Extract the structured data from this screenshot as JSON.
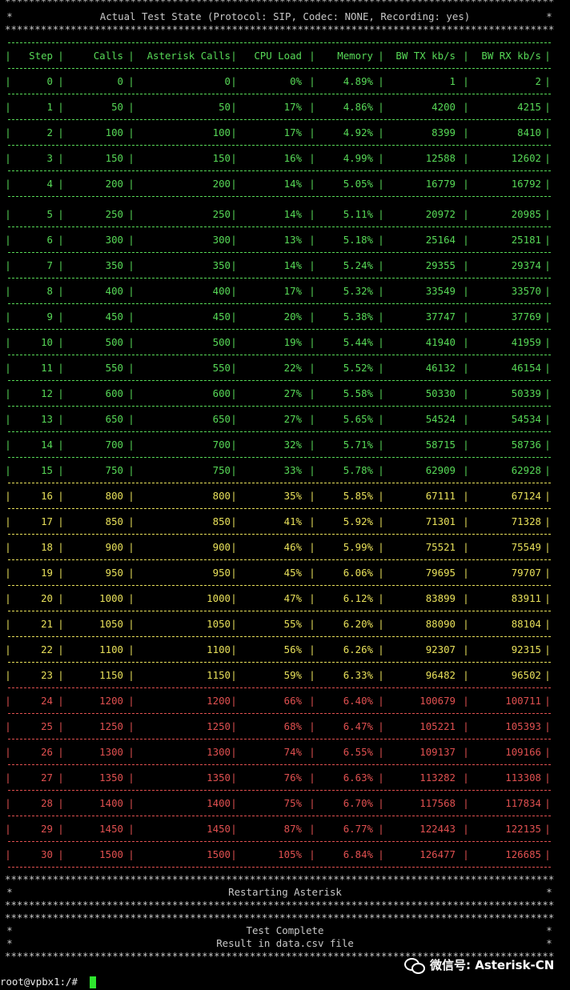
{
  "terminal": {
    "title_line": "Actual Test State (Protocol: SIP, Codec: NONE, Recording: yes)",
    "star_line": "********************************************************************************************",
    "star_char": "*",
    "restart_text": "Restarting Asterisk",
    "complete_text": "Test Complete",
    "result_text": "Result in data.csv file",
    "prompt": "root@vpbx1:/# ",
    "colors": {
      "green": "#57d957",
      "yellow": "#e8e05a",
      "red": "#e05050",
      "border": "#c8c8c8",
      "cursor": "#2ee62e"
    }
  },
  "table": {
    "headers": [
      "Step",
      "Calls",
      "Asterisk Calls",
      "CPU Load",
      "Memory",
      "BW TX kb/s",
      "BW RX kb/s"
    ],
    "rows": [
      {
        "step": "0",
        "calls": "0",
        "ast": "0",
        "cpu": "0%",
        "mem": "4.89%",
        "tx": "1",
        "rx": "2",
        "level": "green"
      },
      {
        "step": "1",
        "calls": "50",
        "ast": "50",
        "cpu": "17%",
        "mem": "4.86%",
        "tx": "4200",
        "rx": "4215",
        "level": "green"
      },
      {
        "step": "2",
        "calls": "100",
        "ast": "100",
        "cpu": "17%",
        "mem": "4.92%",
        "tx": "8399",
        "rx": "8410",
        "level": "green"
      },
      {
        "step": "3",
        "calls": "150",
        "ast": "150",
        "cpu": "16%",
        "mem": "4.99%",
        "tx": "12588",
        "rx": "12602",
        "level": "green"
      },
      {
        "step": "4",
        "calls": "200",
        "ast": "200",
        "cpu": "14%",
        "mem": "5.05%",
        "tx": "16779",
        "rx": "16792",
        "level": "green"
      },
      {
        "step": "5",
        "calls": "250",
        "ast": "250",
        "cpu": "14%",
        "mem": "5.11%",
        "tx": "20972",
        "rx": "20985",
        "level": "green"
      },
      {
        "step": "6",
        "calls": "300",
        "ast": "300",
        "cpu": "13%",
        "mem": "5.18%",
        "tx": "25164",
        "rx": "25181",
        "level": "green"
      },
      {
        "step": "7",
        "calls": "350",
        "ast": "350",
        "cpu": "14%",
        "mem": "5.24%",
        "tx": "29355",
        "rx": "29374",
        "level": "green"
      },
      {
        "step": "8",
        "calls": "400",
        "ast": "400",
        "cpu": "17%",
        "mem": "5.32%",
        "tx": "33549",
        "rx": "33570",
        "level": "green"
      },
      {
        "step": "9",
        "calls": "450",
        "ast": "450",
        "cpu": "20%",
        "mem": "5.38%",
        "tx": "37747",
        "rx": "37769",
        "level": "green"
      },
      {
        "step": "10",
        "calls": "500",
        "ast": "500",
        "cpu": "19%",
        "mem": "5.44%",
        "tx": "41940",
        "rx": "41959",
        "level": "green"
      },
      {
        "step": "11",
        "calls": "550",
        "ast": "550",
        "cpu": "22%",
        "mem": "5.52%",
        "tx": "46132",
        "rx": "46154",
        "level": "green"
      },
      {
        "step": "12",
        "calls": "600",
        "ast": "600",
        "cpu": "27%",
        "mem": "5.58%",
        "tx": "50330",
        "rx": "50339",
        "level": "green"
      },
      {
        "step": "13",
        "calls": "650",
        "ast": "650",
        "cpu": "27%",
        "mem": "5.65%",
        "tx": "54524",
        "rx": "54534",
        "level": "green"
      },
      {
        "step": "14",
        "calls": "700",
        "ast": "700",
        "cpu": "32%",
        "mem": "5.71%",
        "tx": "58715",
        "rx": "58736",
        "level": "green"
      },
      {
        "step": "15",
        "calls": "750",
        "ast": "750",
        "cpu": "33%",
        "mem": "5.78%",
        "tx": "62909",
        "rx": "62928",
        "level": "green"
      },
      {
        "step": "16",
        "calls": "800",
        "ast": "800",
        "cpu": "35%",
        "mem": "5.85%",
        "tx": "67111",
        "rx": "67124",
        "level": "yellow"
      },
      {
        "step": "17",
        "calls": "850",
        "ast": "850",
        "cpu": "41%",
        "mem": "5.92%",
        "tx": "71301",
        "rx": "71328",
        "level": "yellow"
      },
      {
        "step": "18",
        "calls": "900",
        "ast": "900",
        "cpu": "46%",
        "mem": "5.99%",
        "tx": "75521",
        "rx": "75549",
        "level": "yellow"
      },
      {
        "step": "19",
        "calls": "950",
        "ast": "950",
        "cpu": "45%",
        "mem": "6.06%",
        "tx": "79695",
        "rx": "79707",
        "level": "yellow"
      },
      {
        "step": "20",
        "calls": "1000",
        "ast": "1000",
        "cpu": "47%",
        "mem": "6.12%",
        "tx": "83899",
        "rx": "83911",
        "level": "yellow"
      },
      {
        "step": "21",
        "calls": "1050",
        "ast": "1050",
        "cpu": "55%",
        "mem": "6.20%",
        "tx": "88090",
        "rx": "88104",
        "level": "yellow"
      },
      {
        "step": "22",
        "calls": "1100",
        "ast": "1100",
        "cpu": "56%",
        "mem": "6.26%",
        "tx": "92307",
        "rx": "92315",
        "level": "yellow"
      },
      {
        "step": "23",
        "calls": "1150",
        "ast": "1150",
        "cpu": "59%",
        "mem": "6.33%",
        "tx": "96482",
        "rx": "96502",
        "level": "yellow"
      },
      {
        "step": "24",
        "calls": "1200",
        "ast": "1200",
        "cpu": "66%",
        "mem": "6.40%",
        "tx": "100679",
        "rx": "100711",
        "level": "red"
      },
      {
        "step": "25",
        "calls": "1250",
        "ast": "1250",
        "cpu": "68%",
        "mem": "6.47%",
        "tx": "105221",
        "rx": "105393",
        "level": "red"
      },
      {
        "step": "26",
        "calls": "1300",
        "ast": "1300",
        "cpu": "74%",
        "mem": "6.55%",
        "tx": "109137",
        "rx": "109166",
        "level": "red"
      },
      {
        "step": "27",
        "calls": "1350",
        "ast": "1350",
        "cpu": "76%",
        "mem": "6.63%",
        "tx": "113282",
        "rx": "113308",
        "level": "red"
      },
      {
        "step": "28",
        "calls": "1400",
        "ast": "1400",
        "cpu": "75%",
        "mem": "6.70%",
        "tx": "117568",
        "rx": "117834",
        "level": "red"
      },
      {
        "step": "29",
        "calls": "1450",
        "ast": "1450",
        "cpu": "87%",
        "mem": "6.77%",
        "tx": "122443",
        "rx": "122135",
        "level": "red"
      },
      {
        "step": "30",
        "calls": "1500",
        "ast": "1500",
        "cpu": "105%",
        "mem": "6.84%",
        "tx": "126477",
        "rx": "126685",
        "level": "red"
      }
    ]
  },
  "watermark": {
    "text": "微信号: Asterisk-CN",
    "icon": "wechat-icon"
  }
}
